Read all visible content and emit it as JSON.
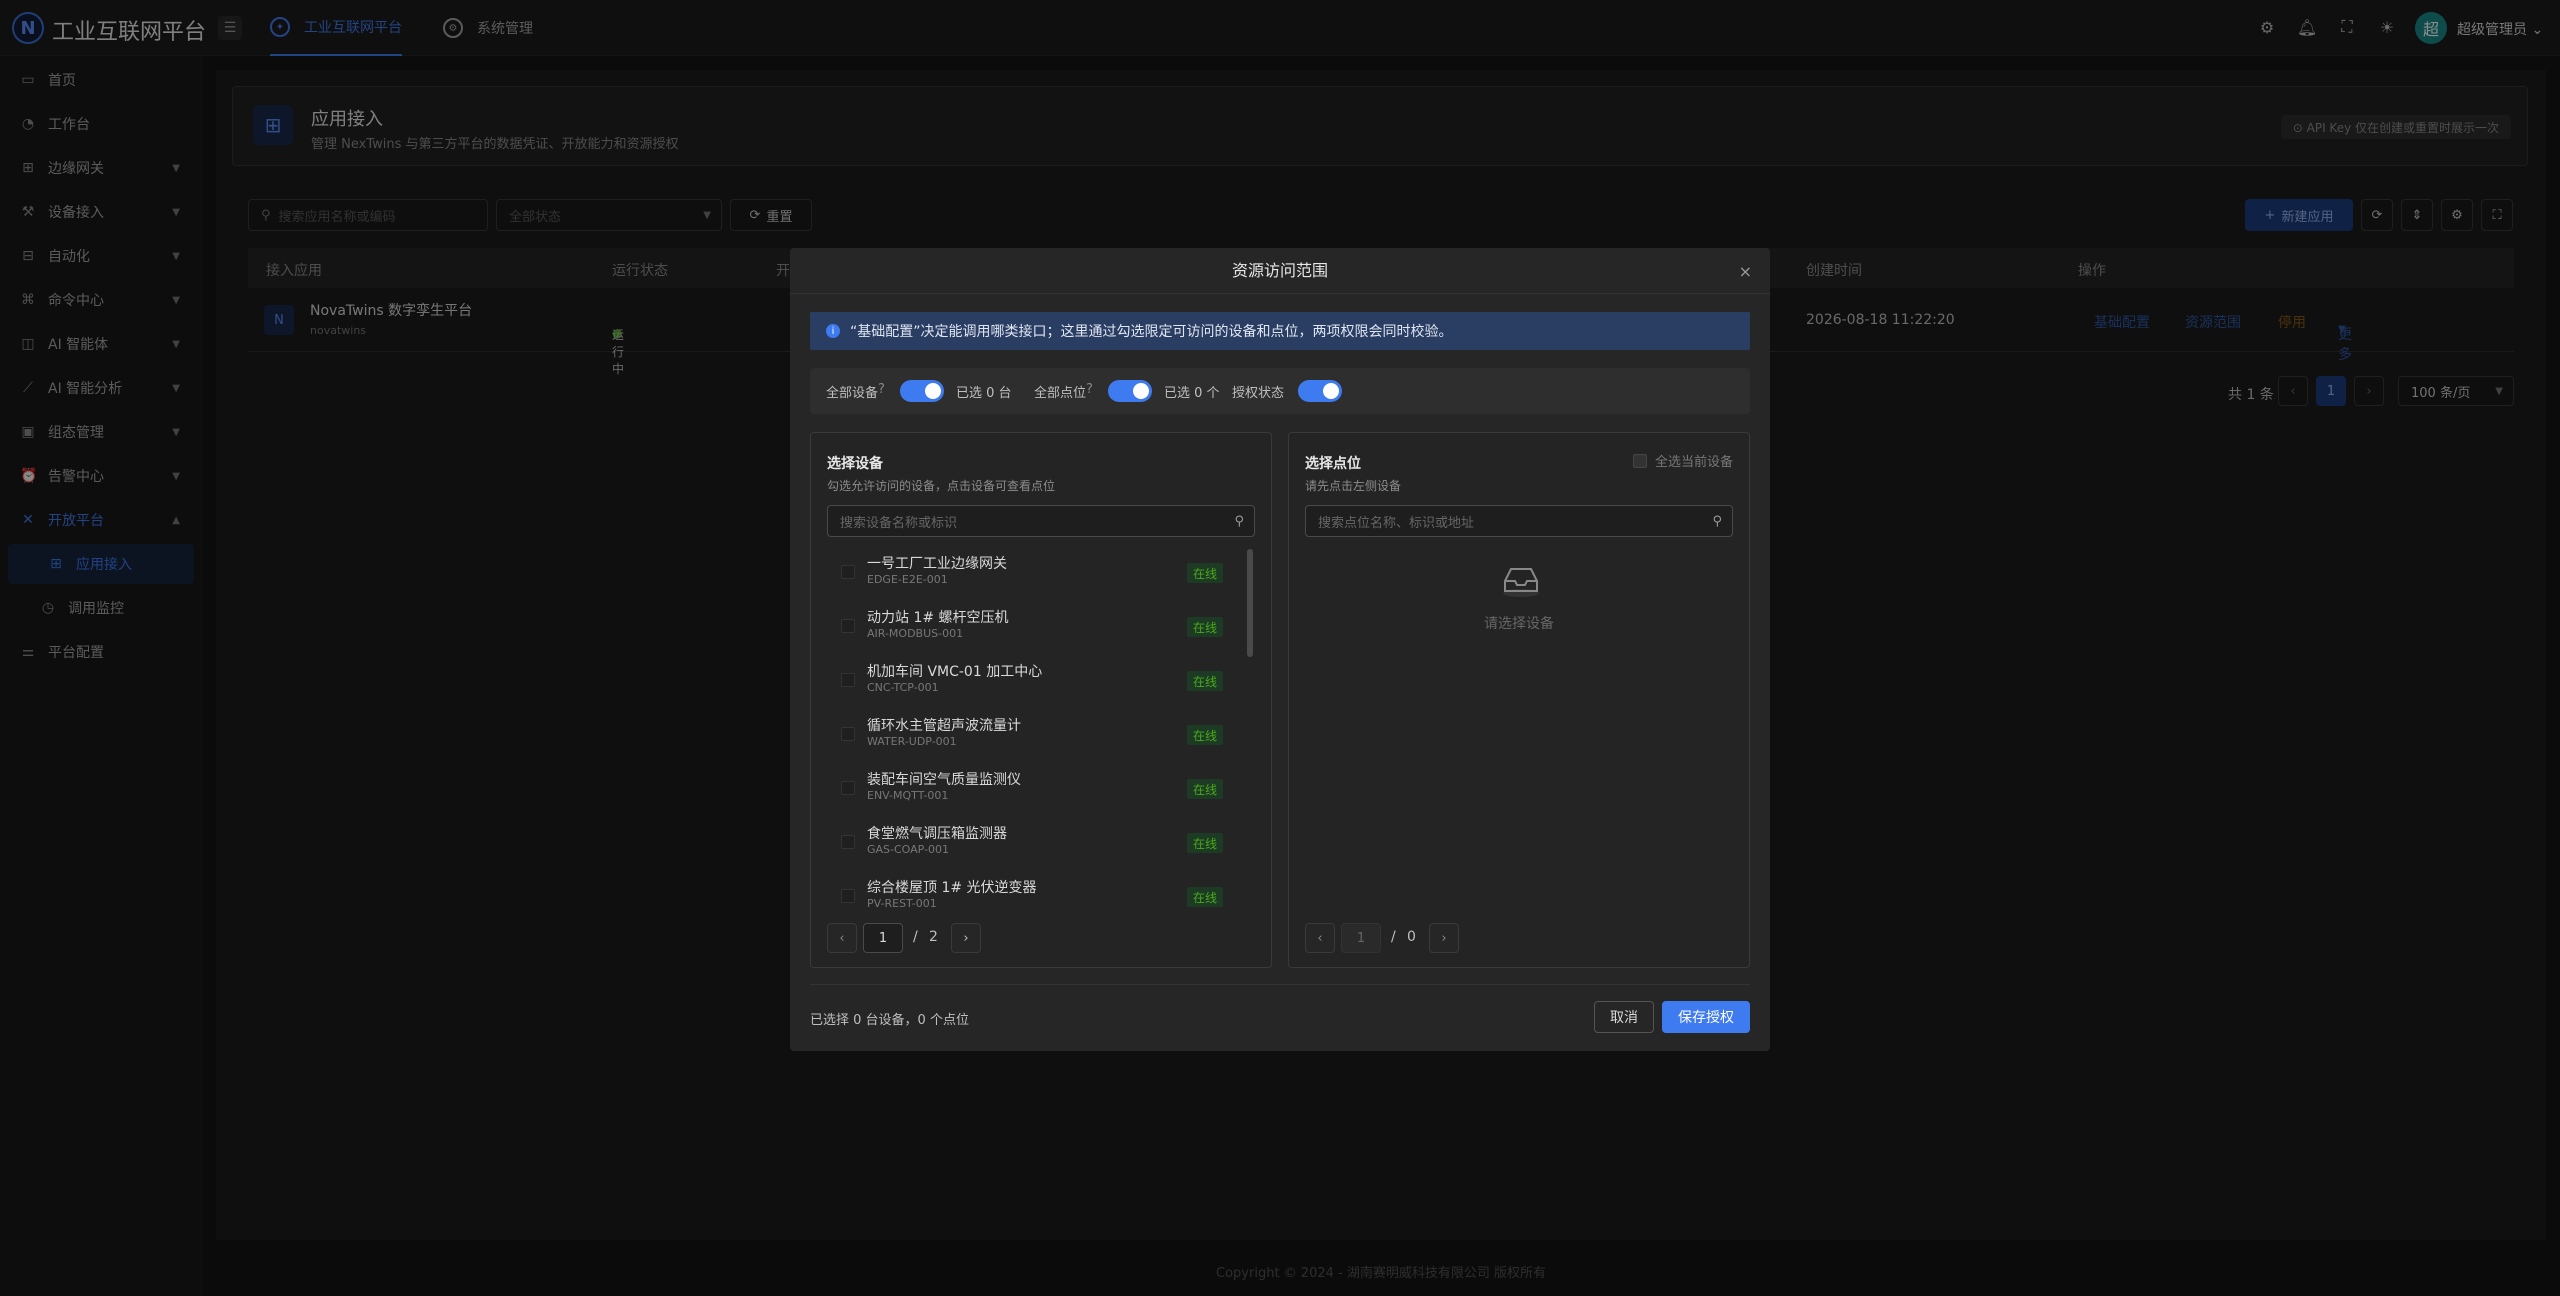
{
  "app": {
    "logo": "N",
    "title": "工业互联网平台"
  },
  "topnav": {
    "tabs": [
      {
        "label": "工业互联网平台",
        "icon": "globe-icon"
      },
      {
        "label": "系统管理",
        "icon": "gear-icon"
      }
    ],
    "icons": [
      "settings-icon",
      "bell-icon",
      "fullscreen-icon",
      "theme-icon"
    ],
    "user": {
      "avatar": "超",
      "name": "超级管理员",
      "caret": "⌄"
    }
  },
  "sidebar": {
    "items": [
      {
        "label": "首页",
        "icon": "monitor-icon"
      },
      {
        "label": "工作台",
        "icon": "dashboard-icon"
      },
      {
        "label": "边缘网关",
        "icon": "gateway-icon"
      },
      {
        "label": "设备接入",
        "icon": "device-icon"
      },
      {
        "label": "自动化",
        "icon": "automation-icon"
      },
      {
        "label": "命令中心",
        "icon": "command-icon"
      },
      {
        "label": "AI 智能体",
        "icon": "robot-icon"
      },
      {
        "label": "AI 智能分析",
        "icon": "chart-icon"
      },
      {
        "label": "组态管理",
        "icon": "layout-icon"
      },
      {
        "label": "告警中心",
        "icon": "alarm-icon"
      },
      {
        "label": "开放平台",
        "icon": "open-platform-icon"
      },
      {
        "label": "应用接入",
        "icon": "app-grid-icon"
      },
      {
        "label": "调用监控",
        "icon": "monitor-call-icon"
      },
      {
        "label": "平台配置",
        "icon": "config-icon"
      }
    ]
  },
  "page": {
    "title": "应用接入",
    "subtitle": "管理 NexTwins 与第三方平台的数据凭证、开放能力和资源授权",
    "badge": "⊙ API Key 仅在创建或重置时展示一次"
  },
  "filters": {
    "search_placeholder": "搜索应用名称或编码",
    "status_placeholder": "全部状态",
    "reset_label": "重置",
    "new_app_label": "新建应用"
  },
  "table": {
    "columns": [
      "接入应用",
      "运行状态",
      "开",
      "创建时间",
      "操作"
    ],
    "rows": [
      {
        "avatar": "N",
        "name": "NovaTwins 数字孪生平台",
        "code": "novatwins",
        "status": "运行中",
        "created": "2026-08-18 11:22:20",
        "actions": [
          "基础配置",
          "资源范围",
          "停用",
          "更多"
        ]
      }
    ]
  },
  "pagination": {
    "total": "共 1 条",
    "current": "1",
    "page_size": "100 条/页"
  },
  "modal": {
    "title": "资源访问范围",
    "close": "×",
    "info": "“基础配置”决定能调用哪类接口；这里通过勾选限定可访问的设备和点位，两项权限会同时校验。",
    "toggles": {
      "all_devices_label": "全部设备",
      "devices_selected": "已选 0 台",
      "all_points_label": "全部点位",
      "points_selected": "已选 0 个",
      "auth_status_label": "授权状态"
    },
    "device_panel": {
      "title": "选择设备",
      "subtitle": "勾选允许访问的设备，点击设备可查看点位",
      "search_placeholder": "搜索设备名称或标识",
      "devices": [
        {
          "name": "一号工厂工业边缘网关",
          "code": "EDGE-E2E-001",
          "status": "在线"
        },
        {
          "name": "动力站 1# 螺杆空压机",
          "code": "AIR-MODBUS-001",
          "status": "在线"
        },
        {
          "name": "机加车间 VMC-01 加工中心",
          "code": "CNC-TCP-001",
          "status": "在线"
        },
        {
          "name": "循环水主管超声波流量计",
          "code": "WATER-UDP-001",
          "status": "在线"
        },
        {
          "name": "装配车间空气质量监测仪",
          "code": "ENV-MQTT-001",
          "status": "在线"
        },
        {
          "name": "食堂燃气调压箱监测器",
          "code": "GAS-COAP-001",
          "status": "在线"
        },
        {
          "name": "综合楼屋顶 1# 光伏逆变器",
          "code": "PV-REST-001",
          "status": "在线"
        }
      ],
      "page": "1",
      "page_sep": "/",
      "total_pages": "2"
    },
    "point_panel": {
      "title": "选择点位",
      "subtitle": "请先点击左侧设备",
      "select_all_label": "全选当前设备",
      "search_placeholder": "搜索点位名称、标识或地址",
      "empty_text": "请选择设备",
      "page": "1",
      "page_sep": "/",
      "total_pages": "0"
    },
    "footer": {
      "summary": "已选择 0 台设备，0 个点位",
      "cancel_label": "取消",
      "save_label": "保存授权"
    }
  },
  "copyright": "Copyright © 2024 - 湖南赛明威科技有限公司 版权所有",
  "colors": {
    "accent": "#3f7bf0",
    "online": "#49aa19",
    "warning": "#d48806"
  }
}
